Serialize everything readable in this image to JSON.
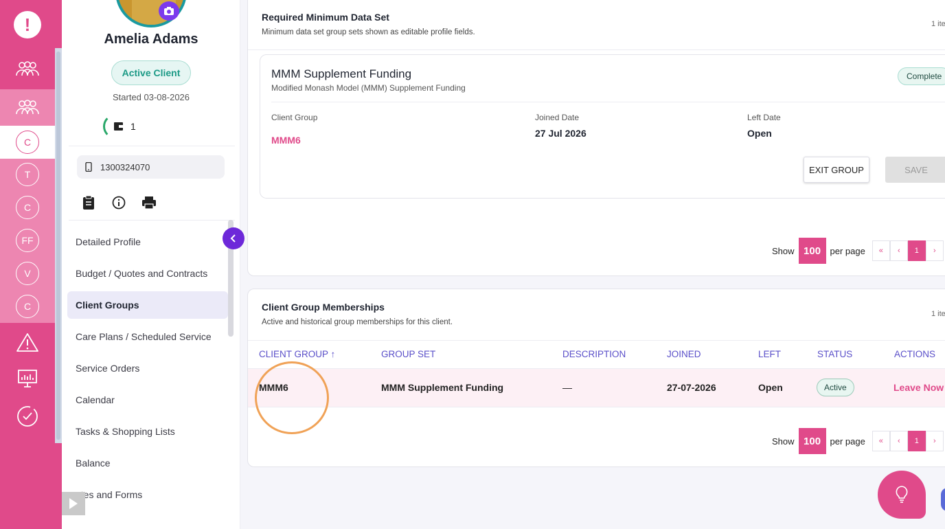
{
  "rail": {
    "letters": [
      "C",
      "T",
      "C",
      "FF",
      "V",
      "C"
    ]
  },
  "profile": {
    "name": "Amelia Adams",
    "status_badge": "Active Client",
    "started": "Started 03-08-2026",
    "wallet_count": "1",
    "phone": "1300324070"
  },
  "menu": {
    "items": [
      {
        "label": "Detailed Profile"
      },
      {
        "label": "Budget / Quotes and Contracts"
      },
      {
        "label": "Client Groups"
      },
      {
        "label": "Care Plans / Scheduled Service"
      },
      {
        "label": "Service Orders"
      },
      {
        "label": "Calendar"
      },
      {
        "label": "Tasks & Shopping Lists"
      },
      {
        "label": "Balance"
      },
      {
        "label": "otes and Forms"
      }
    ]
  },
  "required": {
    "title": "Required Minimum Data Set",
    "subtitle": "Minimum data set group sets shown as editable profile fields.",
    "count": "1 ite",
    "group_card": {
      "title": "MMM Supplement Funding",
      "subtitle": "Modified Monash Model (MMM) Supplement Funding",
      "badge": "Complete",
      "client_group_label": "Client Group",
      "client_group_value": "MMM6",
      "joined_label": "Joined Date",
      "joined_value": "27 Jul 2026",
      "left_label": "Left Date",
      "left_value": "Open",
      "exit_button": "EXIT GROUP",
      "save_button": "SAVE"
    },
    "pager": {
      "show": "Show",
      "per_page_value": "100",
      "per_page": "per page",
      "first": "«",
      "prev": "‹",
      "page": "1",
      "next": "›"
    }
  },
  "memberships": {
    "title": "Client Group Memberships",
    "subtitle": "Active and historical group memberships for this client.",
    "count": "1 ite",
    "columns": [
      "CLIENT GROUP ↑",
      "GROUP SET",
      "DESCRIPTION",
      "JOINED",
      "LEFT",
      "STATUS",
      "ACTIONS"
    ],
    "row": {
      "client_group": "MMM6",
      "group_set": "MMM Supplement Funding",
      "description": "—",
      "joined": "27-07-2026",
      "left": "Open",
      "status": "Active",
      "action": "Leave Now"
    },
    "pager": {
      "show": "Show",
      "per_page_value": "100",
      "per_page": "per page",
      "first": "«",
      "prev": "‹",
      "page": "1",
      "next": "›"
    }
  },
  "colors": {
    "accent": "#e04a8a",
    "purple": "#6d28d9",
    "header": "#5a4fc9"
  }
}
